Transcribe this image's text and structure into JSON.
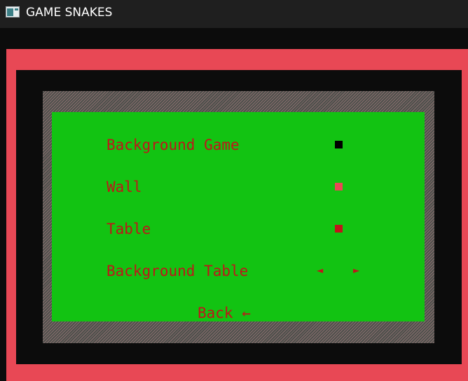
{
  "window": {
    "title": "GAME SNAKES"
  },
  "menu": {
    "items": [
      {
        "label": "Background Game",
        "control": "color-swatch",
        "color": "#000000"
      },
      {
        "label": "Wall",
        "control": "color-swatch",
        "color": "#e84855"
      },
      {
        "label": "Table",
        "control": "color-swatch",
        "color": "#c0151a"
      },
      {
        "label": "Background Table",
        "control": "left-right-arrows",
        "left_arrow": "◄",
        "right_arrow": "►"
      }
    ],
    "back_label": "Back ←"
  },
  "colors": {
    "wall": "#e84855",
    "game_background": "#0c0c0c",
    "table": "#6d5f5f",
    "menu_background": "#12c312",
    "menu_text": "#c0151a",
    "titlebar": "#1f1f1f"
  },
  "icons": {
    "app_icon": "terminal-window-icon"
  }
}
